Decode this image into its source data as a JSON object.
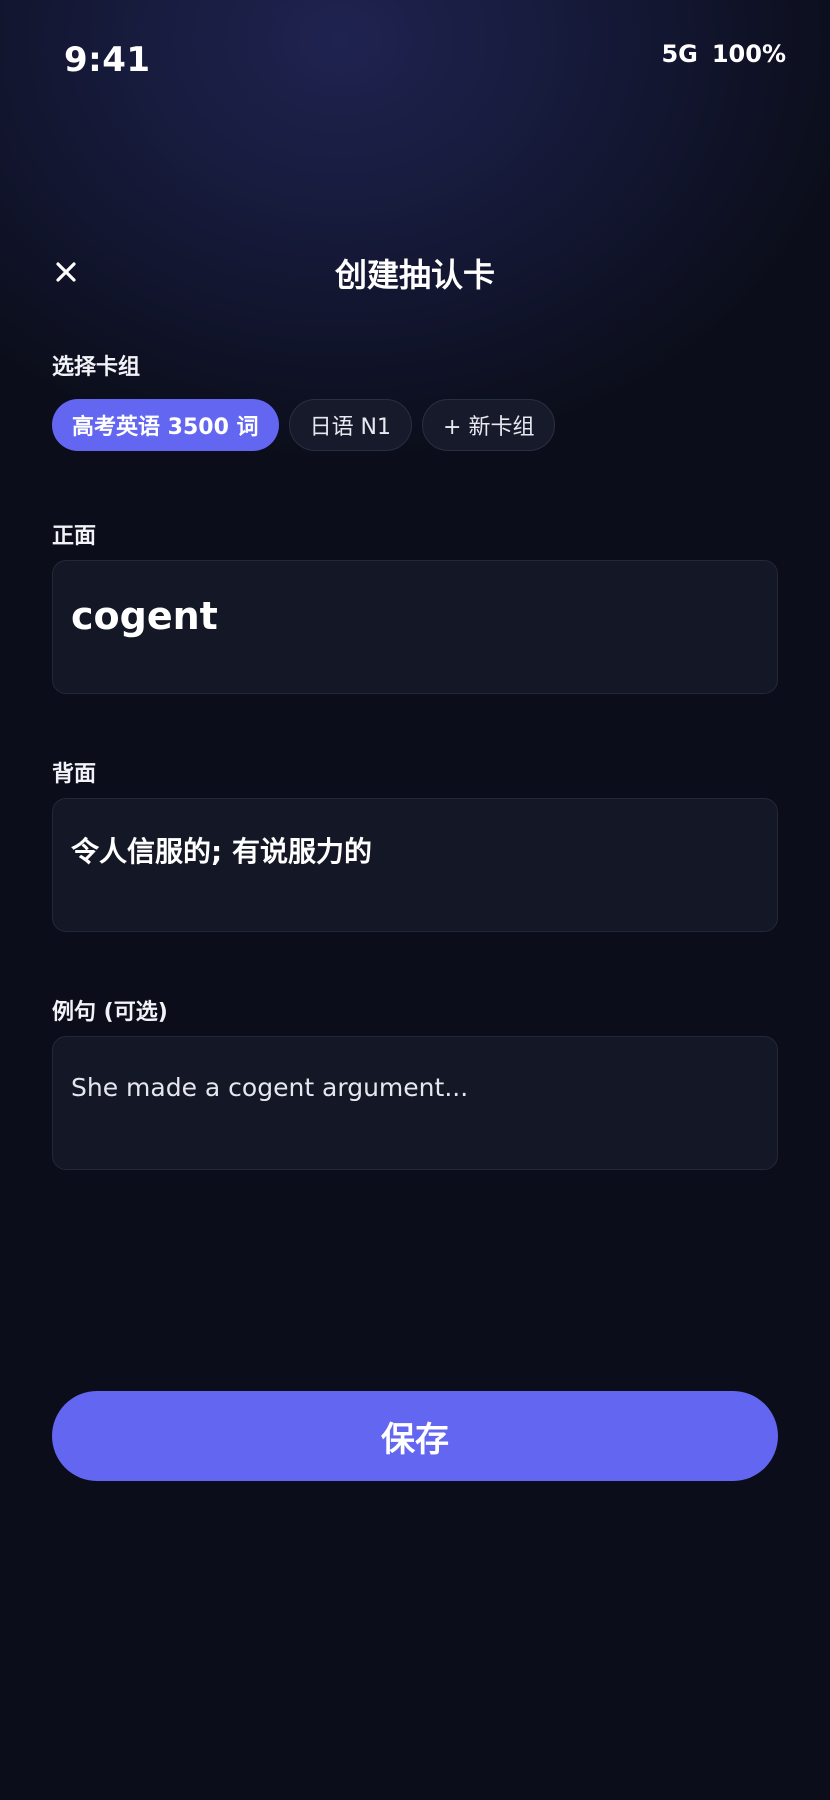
{
  "status_bar": {
    "time": "9:41",
    "network": "5G",
    "battery": "100%"
  },
  "header": {
    "title": "创建抽认卡",
    "close_icon": "close-icon"
  },
  "deck_select": {
    "label": "选择卡组",
    "chips": [
      {
        "label": "高考英语 3500 词",
        "selected": true
      },
      {
        "label": "日语 N1",
        "selected": false
      },
      {
        "label": "+ 新卡组",
        "selected": false
      }
    ]
  },
  "front": {
    "label": "正面",
    "value": "cogent"
  },
  "back": {
    "label": "背面",
    "value": "令人信服的; 有说服力的"
  },
  "example": {
    "label": "例句 (可选)",
    "placeholder": "She made a cogent argument..."
  },
  "save_button": {
    "label": "保存"
  },
  "colors": {
    "background": "#0b0e1a",
    "accent": "#6366f1",
    "field_bg": "#131726",
    "chip_bg": "#171a2b"
  }
}
